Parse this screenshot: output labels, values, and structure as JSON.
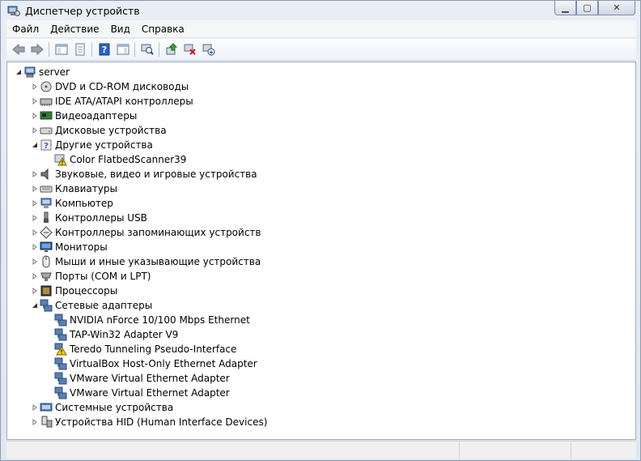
{
  "window": {
    "title": "Диспетчер устройств",
    "min_glyph": "▁",
    "max_glyph": "▢",
    "close_glyph": "✕"
  },
  "menu": [
    "Файл",
    "Действие",
    "Вид",
    "Справка"
  ],
  "toolbar": {
    "icons": [
      "back-arrow-icon",
      "forward-arrow-icon",
      "sep",
      "show-hide-console-tree-icon",
      "properties-icon",
      "sep",
      "help-icon",
      "action-pane-icon",
      "sep",
      "scan-hardware-icon",
      "sep",
      "update-driver-icon",
      "uninstall-icon",
      "disable-device-icon"
    ]
  },
  "tree": {
    "root": "server",
    "items": [
      {
        "label": "DVD и CD-ROM дисководы",
        "level": 1,
        "icon": "dvd-drive-icon",
        "expanded": false
      },
      {
        "label": "IDE ATA/ATAPI контроллеры",
        "level": 1,
        "icon": "ide-controller-icon",
        "expanded": false
      },
      {
        "label": "Видеоадаптеры",
        "level": 1,
        "icon": "display-adapter-icon",
        "expanded": false
      },
      {
        "label": "Дисковые устройства",
        "level": 1,
        "icon": "disk-drive-icon",
        "expanded": false
      },
      {
        "label": "Другие устройства",
        "level": 1,
        "icon": "unknown-device-icon",
        "expanded": true
      },
      {
        "label": "Color FlatbedScanner39",
        "level": 2,
        "icon": "warning-device-icon"
      },
      {
        "label": "Звуковые, видео и игровые устройства",
        "level": 1,
        "icon": "speaker-icon",
        "expanded": false
      },
      {
        "label": "Клавиатуры",
        "level": 1,
        "icon": "keyboard-icon",
        "expanded": false
      },
      {
        "label": "Компьютер",
        "level": 1,
        "icon": "computer-icon",
        "expanded": false
      },
      {
        "label": "Контроллеры USB",
        "level": 1,
        "icon": "usb-icon",
        "expanded": false
      },
      {
        "label": "Контроллеры запоминающих устройств",
        "level": 1,
        "icon": "storage-controller-icon",
        "expanded": false
      },
      {
        "label": "Мониторы",
        "level": 1,
        "icon": "monitor-icon",
        "expanded": false
      },
      {
        "label": "Мыши и иные указывающие устройства",
        "level": 1,
        "icon": "mouse-icon",
        "expanded": false
      },
      {
        "label": "Порты (COM и LPT)",
        "level": 1,
        "icon": "port-icon",
        "expanded": false
      },
      {
        "label": "Процессоры",
        "level": 1,
        "icon": "processor-icon",
        "expanded": false
      },
      {
        "label": "Сетевые адаптеры",
        "level": 1,
        "icon": "network-adapter-icon",
        "expanded": true
      },
      {
        "label": "NVIDIA nForce 10/100 Mbps Ethernet",
        "level": 2,
        "icon": "network-adapter-icon"
      },
      {
        "label": "TAP-Win32 Adapter V9",
        "level": 2,
        "icon": "network-adapter-icon"
      },
      {
        "label": "Teredo Tunneling Pseudo-Interface",
        "level": 2,
        "icon": "warning-network-icon"
      },
      {
        "label": "VirtualBox Host-Only Ethernet Adapter",
        "level": 2,
        "icon": "network-adapter-icon"
      },
      {
        "label": "VMware Virtual Ethernet Adapter",
        "level": 2,
        "icon": "network-adapter-icon"
      },
      {
        "label": "VMware Virtual Ethernet Adapter",
        "level": 2,
        "icon": "network-adapter-icon"
      },
      {
        "label": "Системные устройства",
        "level": 1,
        "icon": "system-device-icon",
        "expanded": false
      },
      {
        "label": "Устройства HID (Human Interface Devices)",
        "level": 1,
        "icon": "hid-icon",
        "expanded": false
      }
    ]
  }
}
